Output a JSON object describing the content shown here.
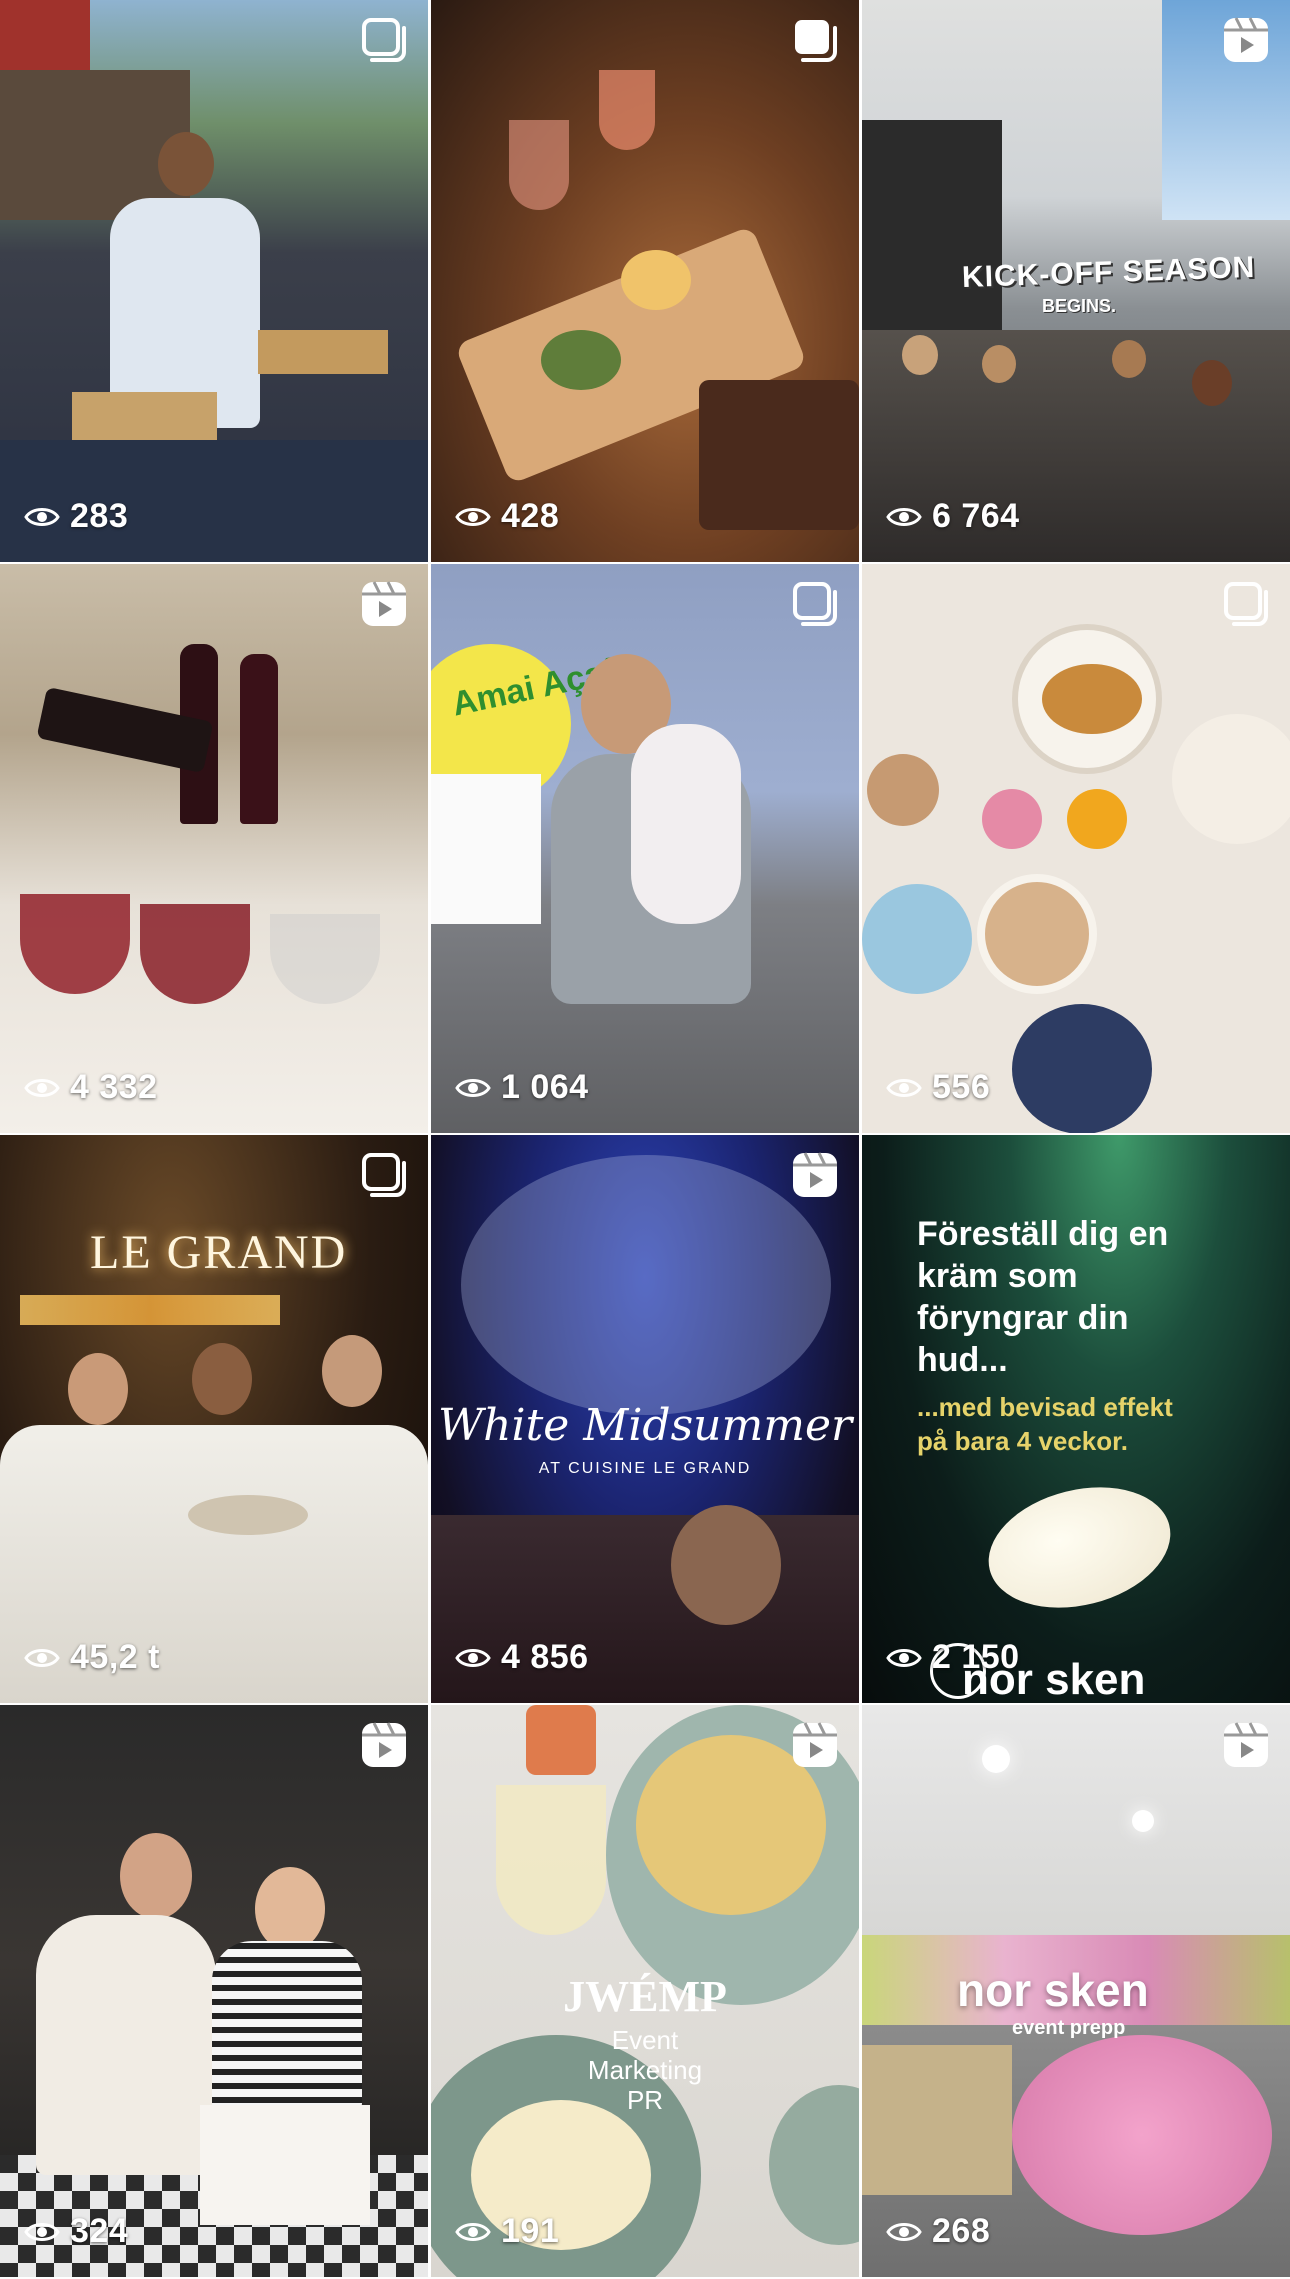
{
  "grid": {
    "posts": [
      {
        "views": "283",
        "type": "carousel"
      },
      {
        "views": "428",
        "type": "carousel"
      },
      {
        "views": "6 764",
        "type": "reel",
        "overlay": {
          "title": "KICK-OFF SEASON",
          "subtitle": "BEGINS."
        }
      },
      {
        "views": "4 332",
        "type": "reel"
      },
      {
        "views": "1 064",
        "type": "carousel",
        "overlay": {
          "brand": "Amai Açaí"
        }
      },
      {
        "views": "556",
        "type": "carousel"
      },
      {
        "views": "45,2 t",
        "type": "carousel",
        "overlay": {
          "sign": "LE GRAND"
        }
      },
      {
        "views": "4 856",
        "type": "reel",
        "overlay": {
          "title": "White Midsummer",
          "subtitle": "AT CUISINE LE GRAND"
        }
      },
      {
        "views": "2 150",
        "type": "none",
        "overlay": {
          "headline": "Föreställ dig en\nkräm som\nföryngrar din\nhud...",
          "tagline": "...med bevisad effekt\npå bara 4 veckor.",
          "brand": "nor sken"
        }
      },
      {
        "views": "324",
        "type": "reel"
      },
      {
        "views": "191",
        "type": "reel",
        "overlay": {
          "title": "JWÉMP",
          "subtitle": "Event\nMarketing\nPR"
        }
      },
      {
        "views": "268",
        "type": "reel",
        "overlay": {
          "title": "nor sken",
          "subtitle": "event prepp"
        }
      }
    ]
  },
  "icons": {
    "views": "eye-icon",
    "carousel": "carousel-icon",
    "reel": "reel-icon"
  },
  "colors": {
    "overlay_text": "#ffffff",
    "ad_accent": "#e6d36a",
    "ad_background": "#0b2a24"
  }
}
